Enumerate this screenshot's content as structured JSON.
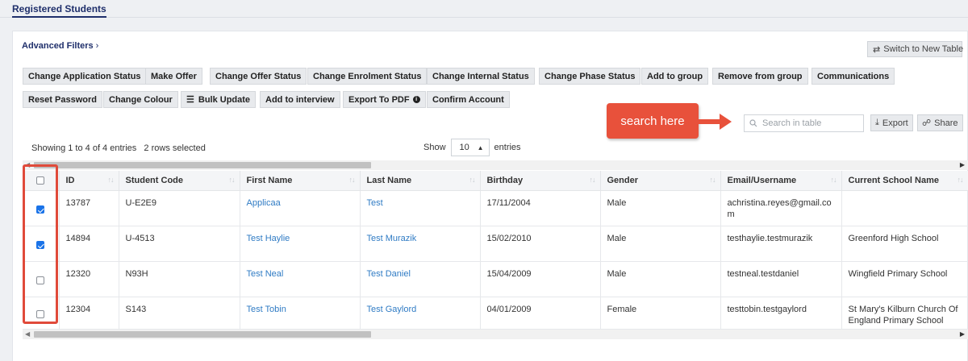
{
  "tabs": {
    "active": "Registered Students"
  },
  "filters": {
    "label": "Advanced Filters",
    "chevron_icon": "chevron-right-icon"
  },
  "switch_table": {
    "label": "Switch to New Table",
    "icon": "swap-arrows-icon"
  },
  "actions_row1": [
    "Change Application Status",
    "Make Offer",
    "Change Offer Status",
    "Change Enrolment Status",
    "Change Internal Status",
    "Change Phase Status",
    "Add to group",
    "Remove from group",
    "Communications"
  ],
  "actions_row2": {
    "reset_password": "Reset Password",
    "change_colour": "Change Colour",
    "bulk_update": "Bulk Update",
    "add_to_interview": "Add to interview",
    "export_pdf": "Export To PDF",
    "confirm_account": "Confirm Account"
  },
  "annotation": {
    "text": "search here",
    "color": "#e8513b"
  },
  "search": {
    "placeholder": "Search in table"
  },
  "toolbar": {
    "export": "Export",
    "share": "Share"
  },
  "table_info": {
    "showing": "Showing 1 to 4 of 4 entries",
    "selected": "2 rows selected"
  },
  "page_length": {
    "show": "Show",
    "value": "10",
    "entries": "entries"
  },
  "columns": [
    "ID",
    "Student Code",
    "First Name",
    "Last Name",
    "Birthday",
    "Gender",
    "Email/Username",
    "Current School Name"
  ],
  "rows": [
    {
      "checked": true,
      "id": "13787",
      "code": "U-E2E9",
      "first": "Applicaa",
      "last": "Test",
      "birthday": "17/11/2004",
      "gender": "Male",
      "email": "achristina.reyes@gmail.co m",
      "school": ""
    },
    {
      "checked": true,
      "id": "14894",
      "code": "U-4513",
      "first": "Test Haylie",
      "last": "Test Murazik",
      "birthday": "15/02/2010",
      "gender": "Male",
      "email": "testhaylie.testmurazik",
      "school": "Greenford High School"
    },
    {
      "checked": false,
      "id": "12320",
      "code": "N93H",
      "first": "Test Neal",
      "last": "Test Daniel",
      "birthday": "15/04/2009",
      "gender": "Male",
      "email": "testneal.testdaniel",
      "school": "Wingfield Primary School"
    },
    {
      "checked": false,
      "id": "12304",
      "code": "S143",
      "first": "Test Tobin",
      "last": "Test Gaylord",
      "birthday": "04/01/2009",
      "gender": "Female",
      "email": "testtobin.testgaylord",
      "school": "St Mary's Kilburn Church Of England Primary School"
    }
  ],
  "colors": {
    "accent": "#1f2f6b",
    "link": "#2f7bc4",
    "checkbox": "#1a73e8",
    "highlight": "#e04a3a"
  }
}
